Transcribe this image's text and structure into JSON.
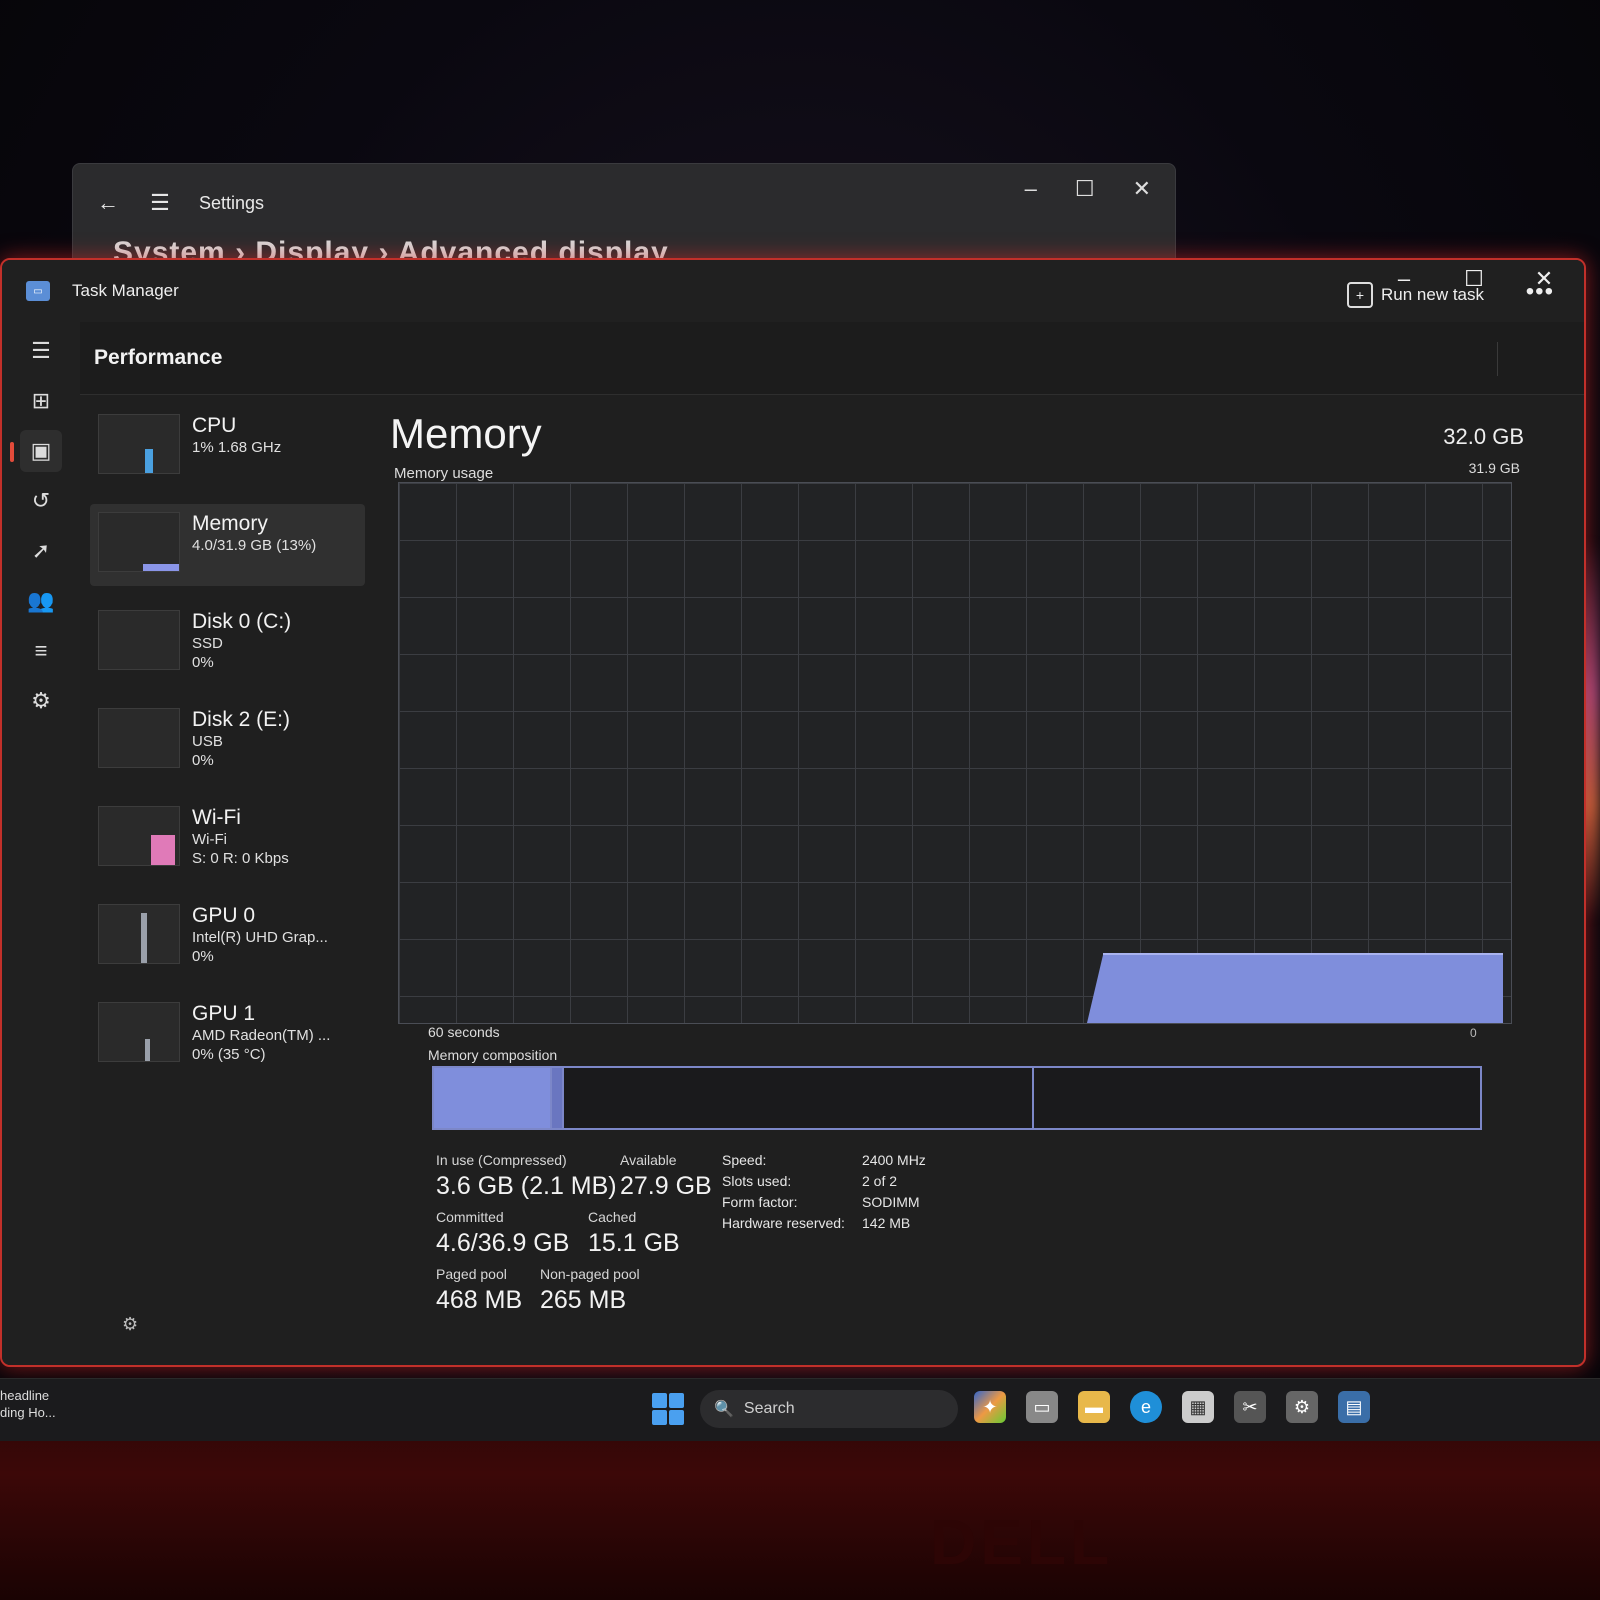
{
  "settings_window": {
    "title": "Settings",
    "breadcrumb": "System  ›  Display  ›  Advanced display"
  },
  "task_manager": {
    "title": "Task Manager",
    "header": {
      "page": "Performance",
      "run_new_task": "Run new task",
      "more": "•••"
    },
    "resources": [
      {
        "name": "CPU",
        "line1": "1% 1.68 GHz",
        "line2": "",
        "line3": "",
        "color": "#4aa0e0"
      },
      {
        "name": "Memory",
        "line1": "4.0/31.9 GB (13%)",
        "line2": "",
        "line3": "",
        "color": "#8a95e8"
      },
      {
        "name": "Disk 0 (C:)",
        "line1": "SSD",
        "line2": "0%",
        "line3": "",
        "color": "#6fbf5f"
      },
      {
        "name": "Disk 2 (E:)",
        "line1": "USB",
        "line2": "0%",
        "line3": "",
        "color": "#6fbf5f"
      },
      {
        "name": "Wi-Fi",
        "line1": "Wi-Fi",
        "line2": "S: 0 R: 0 Kbps",
        "line3": "",
        "color": "#e07ab8"
      },
      {
        "name": "GPU 0",
        "line1": "Intel(R) UHD Grap...",
        "line2": "0%",
        "line3": "",
        "color": "#4aa0e0"
      },
      {
        "name": "GPU 1",
        "line1": "AMD Radeon(TM) ...",
        "line2": "0% (35 °C)",
        "line3": "",
        "color": "#4aa0e0"
      }
    ],
    "memory": {
      "title": "Memory",
      "total": "32.0 GB",
      "usage_label": "Memory usage",
      "usage_max": "31.9 GB",
      "time_span": "60 seconds",
      "axis_min": "0",
      "composition_label": "Memory composition",
      "usage_fraction": 0.125,
      "stats": {
        "in_use_label": "In use (Compressed)",
        "in_use_value": "3.6 GB (2.1 MB)",
        "available_label": "Available",
        "available_value": "27.9 GB",
        "committed_label": "Committed",
        "committed_value": "4.6/36.9 GB",
        "cached_label": "Cached",
        "cached_value": "15.1 GB",
        "paged_pool_label": "Paged pool",
        "paged_pool_value": "468 MB",
        "nonpaged_pool_label": "Non-paged pool",
        "nonpaged_pool_value": "265 MB"
      },
      "hardware": {
        "speed_label": "Speed:",
        "speed_value": "2400 MHz",
        "slots_label": "Slots used:",
        "slots_value": "2 of 2",
        "form_label": "Form factor:",
        "form_value": "SODIMM",
        "reserved_label": "Hardware reserved:",
        "reserved_value": "142 MB"
      }
    }
  },
  "taskbar": {
    "news_line1": "headline",
    "news_line2": "ding Ho...",
    "search_placeholder": "Search"
  },
  "accent_color": "#8a95e8",
  "window_border_color": "#c2302a"
}
